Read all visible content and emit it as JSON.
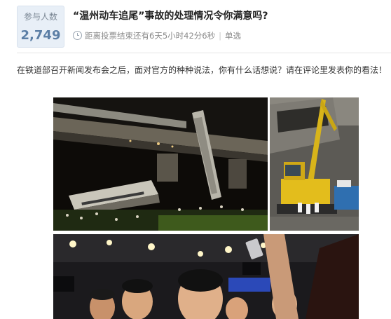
{
  "poll": {
    "participants_label": "参与人数",
    "participants_count": "2,749",
    "title": "“温州动车追尾”事故的处理情况令你满意吗?",
    "countdown": "距离投票结束还有6天5小时42分6秒",
    "separator": "|",
    "mode": "单选",
    "icon": "clock-icon"
  },
  "intro": {
    "text": "在铁道部召开新闻发布会之后，面对官方的种种说法，你有什么话想说？请在评论里发表你的看法！"
  },
  "photos": [
    {
      "name": "train-crash-viaduct-night-photo"
    },
    {
      "name": "excavator-wreckage-photo"
    },
    {
      "name": "press-conference-photo"
    }
  ],
  "colors": {
    "count_bg": "#e8eff7",
    "count_value": "#5c7fa6",
    "title": "#222222",
    "meta": "#8a8a8a"
  }
}
